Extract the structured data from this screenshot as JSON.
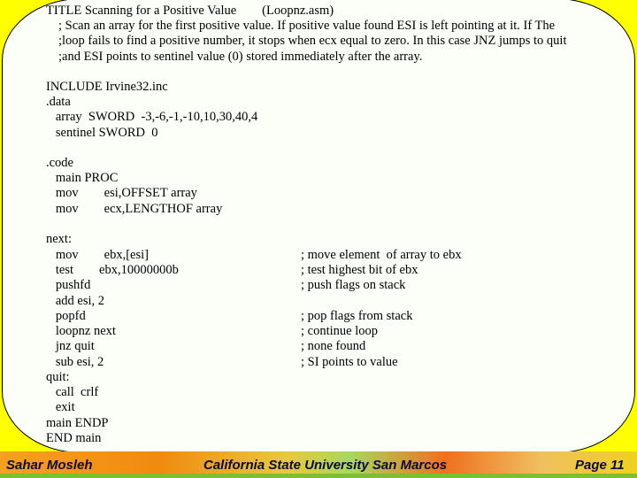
{
  "header": {
    "lines": [
      "TITLE Scanning for a Positive Value        (Loopnz.asm)",
      "; Scan an array for the first positive value. If positive value found ESI is left pointing at it. If The",
      ";loop fails to find a positive number, it stops when ecx equal to zero. In this case JNZ jumps to quit",
      ";and ESI points to sentinel value (0) stored immediately after the array."
    ]
  },
  "code": [
    "INCLUDE Irvine32.inc",
    ".data",
    "   array  SWORD  -3,-6,-1,-10,10,30,40,4",
    "   sentinel SWORD  0",
    "",
    ".code",
    "   main PROC",
    "   mov        esi,OFFSET array",
    "   mov        ecx,LENGTHOF array",
    "",
    "next:",
    "   mov        ebx,[esi]",
    "   test        ebx,10000000b",
    "   pushfd",
    "   add esi, 2",
    "   popfd",
    "   loopnz next",
    "   jnz quit",
    "   sub esi, 2",
    "quit:",
    "   call  crlf",
    "   exit",
    "main ENDP",
    "END main"
  ],
  "comments": [
    {
      "line": 11,
      "text": "; move element  of array to ebx"
    },
    {
      "line": 12,
      "text": "; test highest bit of ebx"
    },
    {
      "line": 13,
      "text": "; push flags on stack"
    },
    {
      "line": 15,
      "text": "; pop flags from stack"
    },
    {
      "line": 16,
      "text": "; continue loop"
    },
    {
      "line": 17,
      "text": "; none found"
    },
    {
      "line": 18,
      "text": "; SI points to value"
    }
  ],
  "footer": {
    "author": "Sahar Mosleh",
    "institution": "California State University San Marcos",
    "page": "Page 11"
  },
  "colors": {
    "background": "#ffff00",
    "panel": "#fbfff8",
    "footer_text": "#0a0a40"
  }
}
